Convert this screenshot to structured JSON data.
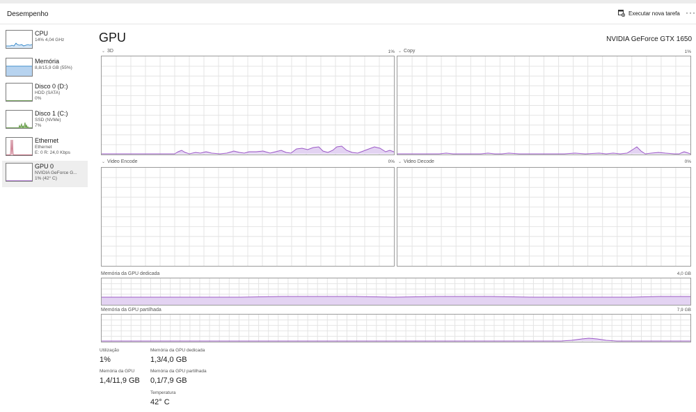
{
  "header": {
    "title": "Desempenho",
    "run_task_label": "Executar nova tarefa",
    "more_label": "···"
  },
  "sidebar": {
    "items": [
      {
        "name": "CPU",
        "line1": "14% 4,04 GHz",
        "line2": ""
      },
      {
        "name": "Memória",
        "line1": "8,8/15,9 GB (55%)",
        "line2": ""
      },
      {
        "name": "Disco 0 (D:)",
        "line1": "HDD (SATA)",
        "line2": "0%"
      },
      {
        "name": "Disco 1 (C:)",
        "line1": "SSD (NVMe)",
        "line2": "7%"
      },
      {
        "name": "Ethernet",
        "line1": "Ethernet",
        "line2": "E: 0 R: 24,0 Kbps"
      },
      {
        "name": "GPU 0",
        "line1": "NVIDIA GeForce G...",
        "line2": "1% (42° C)"
      }
    ]
  },
  "main": {
    "title": "GPU",
    "model": "NVIDIA GeForce GTX 1650",
    "panels": {
      "p3d": {
        "label": "3D",
        "pct": "1%"
      },
      "copy": {
        "label": "Copy",
        "pct": "1%"
      },
      "encode": {
        "label": "Video Encode",
        "pct": "0%"
      },
      "decode": {
        "label": "Video Decode",
        "pct": "0%"
      },
      "dedicated": {
        "label": "Memória da GPU dedicada",
        "max": "4,0 GB"
      },
      "shared": {
        "label": "Memória da GPU partilhada",
        "max": "7,9 GB"
      }
    },
    "stats": {
      "utilization": {
        "label": "Utilização",
        "value": "1%"
      },
      "gpu_memory": {
        "label": "Memória da GPU",
        "value": "1,4/11,9 GB"
      },
      "dedicated_memory": {
        "label": "Memória da GPU dedicada",
        "value": "1,3/4,0 GB"
      },
      "shared_memory": {
        "label": "Memória da GPU partilhada",
        "value": "0,1/7,9 GB"
      },
      "temperature": {
        "label": "Temperatura",
        "value": "42° C"
      }
    }
  },
  "colors": {
    "gpu_line": "#9b59c6",
    "gpu_fill": "#e3d3f2",
    "cpu_line": "#1a78c2",
    "memory_fill": "#b7d3ef",
    "disk_green": "#4e8a2e",
    "ethernet_red": "#b0415a",
    "grid": "#e4e4e4"
  }
}
